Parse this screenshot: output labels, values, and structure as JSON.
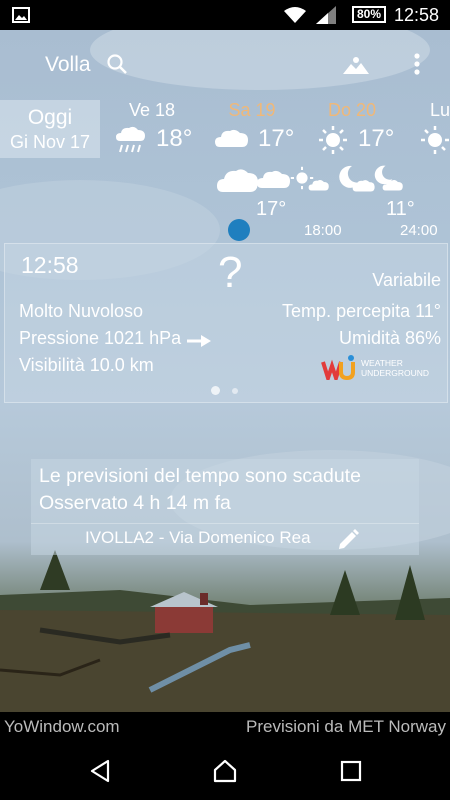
{
  "status_bar": {
    "battery": "80%",
    "time": "12:58"
  },
  "header": {
    "city": "Volla"
  },
  "forecast_days": [
    {
      "name": "Oggi",
      "date": "Gi Nov 17"
    },
    {
      "name": "Ve 18",
      "temp": "18°"
    },
    {
      "name": "Sa 19",
      "temp": "17°"
    },
    {
      "name": "Do 20",
      "temp": "17°"
    },
    {
      "name": "Lu",
      "temp": ""
    }
  ],
  "hourly": {
    "temp1": "17°",
    "time1": "18:00",
    "temp2": "11°",
    "time2": "24:00"
  },
  "current": {
    "time": "12:58",
    "unknown_symbol": "?",
    "condition": "Variabile",
    "sky": "Molto Nuvoloso",
    "feels_like": "Temp. percepita 11°",
    "pressure": "Pressione 1021 hPa",
    "humidity": "Umidità 86%",
    "visibility": "Visibilità 10.0 km",
    "provider_logo_text": "WEATHER UNDERGROUND"
  },
  "observation": {
    "expired_line": "Le previsioni del tempo sono scadute",
    "observed_line": "Osservato 4 h 14 m fa",
    "station": "IVOLLA2 - Via Domenico Rea"
  },
  "footer": {
    "left": "YoWindow.com",
    "right": "Previsioni da MET Norway"
  },
  "colors": {
    "weekend_day": "#f0b878",
    "accent_dot": "#1f7fbf"
  }
}
